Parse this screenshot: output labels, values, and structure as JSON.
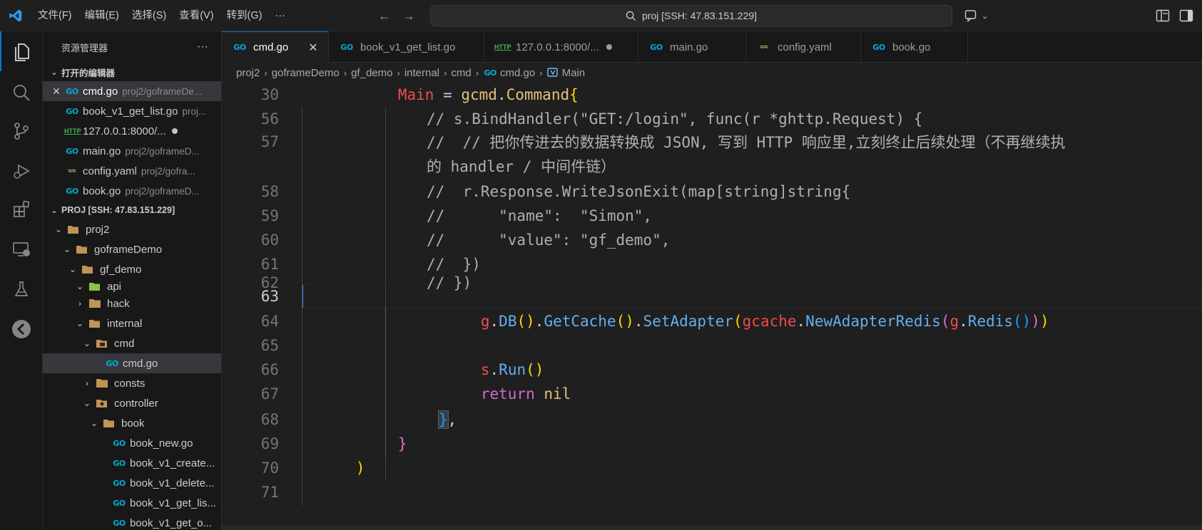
{
  "titlebar": {
    "menu": [
      "文件(F)",
      "编辑(E)",
      "选择(S)",
      "查看(V)",
      "转到(G)",
      "···"
    ],
    "search_text": "proj [SSH: 47.83.151.229]"
  },
  "sidebar": {
    "title": "资源管理器",
    "more": "···",
    "open_editors_label": "打开的编辑器",
    "open_editors": [
      {
        "name": "cmd.go",
        "path": "proj2/goframeDe...",
        "icon": "go"
      },
      {
        "name": "book_v1_get_list.go",
        "path": "proj...",
        "icon": "go"
      },
      {
        "name": "127.0.0.1:8000/...",
        "path": "",
        "icon": "http"
      },
      {
        "name": "main.go",
        "path": "proj2/goframeD...",
        "icon": "go"
      },
      {
        "name": "config.yaml",
        "path": "proj2/gofra...",
        "icon": "yaml"
      },
      {
        "name": "book.go",
        "path": "proj2/goframeD...",
        "icon": "go"
      }
    ],
    "workspace_label": "PROJ [SSH: 47.83.151.229]",
    "tree": [
      {
        "name": "proj2",
        "type": "folder"
      },
      {
        "name": "goframeDemo",
        "type": "folder"
      },
      {
        "name": "gf_demo",
        "type": "folder"
      },
      {
        "name": "api",
        "type": "folder"
      },
      {
        "name": "hack",
        "type": "folder"
      },
      {
        "name": "internal",
        "type": "folder"
      },
      {
        "name": "cmd",
        "type": "folder"
      },
      {
        "name": "cmd.go",
        "type": "go"
      },
      {
        "name": "consts",
        "type": "folder"
      },
      {
        "name": "controller",
        "type": "folder"
      },
      {
        "name": "book",
        "type": "folder"
      },
      {
        "name": "book_new.go",
        "type": "go"
      },
      {
        "name": "book_v1_create...",
        "type": "go"
      },
      {
        "name": "book_v1_delete...",
        "type": "go"
      },
      {
        "name": "book_v1_get_lis...",
        "type": "go"
      },
      {
        "name": "book_v1_get_o...",
        "type": "go"
      }
    ]
  },
  "tabs": [
    {
      "label": "cmd.go",
      "icon": "go"
    },
    {
      "label": "book_v1_get_list.go",
      "icon": "go"
    },
    {
      "label": "127.0.0.1:8000/...",
      "icon": "http"
    },
    {
      "label": "main.go",
      "icon": "go"
    },
    {
      "label": "config.yaml",
      "icon": "yaml"
    },
    {
      "label": "book.go",
      "icon": "go"
    }
  ],
  "breadcrumb": [
    "proj2",
    "goframeDemo",
    "gf_demo",
    "internal",
    "cmd",
    "cmd.go",
    "Main"
  ],
  "editor": {
    "current_line": "63",
    "lines": [
      {
        "n": "30",
        "t": [
          "Main",
          " = ",
          "gcmd",
          ".",
          "Command",
          "{"
        ]
      },
      {
        "n": "56",
        "t": [
          "// s.BindHandler(\"GET:/login\", func(r *ghttp.Request) {"
        ]
      },
      {
        "n": "57",
        "t": [
          "//  // 把你传进去的数据转换成 JSON, 写到 HTTP 响应里,立刻终止后续处理（不再继续执"
        ]
      },
      {
        "n": "",
        "t": [
          "的 handler / 中间件链）"
        ]
      },
      {
        "n": "58",
        "t": [
          "//  r.Response.WriteJsonExit(map[string]string{"
        ]
      },
      {
        "n": "59",
        "t": [
          "//      \"name\":  \"Simon\","
        ]
      },
      {
        "n": "60",
        "t": [
          "//      \"value\": \"gf_demo\","
        ]
      },
      {
        "n": "61",
        "t": [
          "//  })"
        ]
      },
      {
        "n": "62",
        "t": [
          "// })"
        ]
      },
      {
        "n": "63",
        "t": [
          ""
        ]
      },
      {
        "n": "64",
        "t": [
          "g",
          ".",
          "DB",
          "(",
          ")",
          ".",
          "GetCache",
          "(",
          ")",
          ".",
          "SetAdapter",
          "(",
          "gcache",
          ".",
          "NewAdapterRedis",
          "(",
          "g",
          ".",
          "Redis",
          "(",
          ")",
          ")",
          ")"
        ]
      },
      {
        "n": "65",
        "t": [
          ""
        ]
      },
      {
        "n": "66",
        "t": [
          "s",
          ".",
          "Run",
          "(",
          ")"
        ]
      },
      {
        "n": "67",
        "t": [
          "return",
          " ",
          "nil"
        ]
      },
      {
        "n": "68",
        "t": [
          "}",
          ","
        ]
      },
      {
        "n": "69",
        "t": [
          "}"
        ]
      },
      {
        "n": "70",
        "t": [
          ")"
        ]
      },
      {
        "n": "71",
        "t": [
          ""
        ]
      }
    ]
  },
  "colors": {
    "accent": "#0078d4",
    "go_icon": "#00acd7",
    "keyword": "#c586c0",
    "variable": "#f14c4c",
    "function": "#61afef"
  }
}
